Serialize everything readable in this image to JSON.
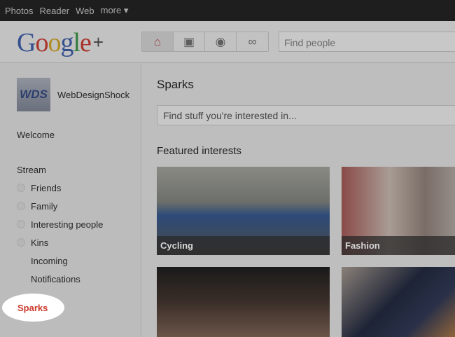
{
  "topbar": {
    "items": [
      "Photos",
      "Reader",
      "Web",
      "more ▾"
    ]
  },
  "header": {
    "logo": "Google+",
    "search_placeholder": "Find people",
    "nav_icons": [
      "home-icon",
      "photos-icon",
      "profile-icon",
      "circles-icon"
    ]
  },
  "sidebar": {
    "user": "WebDesignShock",
    "avatar_text": "WDS",
    "welcome": "Welcome",
    "stream": "Stream",
    "circles": [
      "Friends",
      "Family",
      "Interesting people",
      "Kins"
    ],
    "incoming": "Incoming",
    "notifications": "Notifications",
    "sparks": "Sparks"
  },
  "main": {
    "title": "Sparks",
    "search_placeholder": "Find stuff you're interested in...",
    "featured": "Featured interests",
    "tiles": [
      "Cycling",
      "Fashion"
    ]
  }
}
